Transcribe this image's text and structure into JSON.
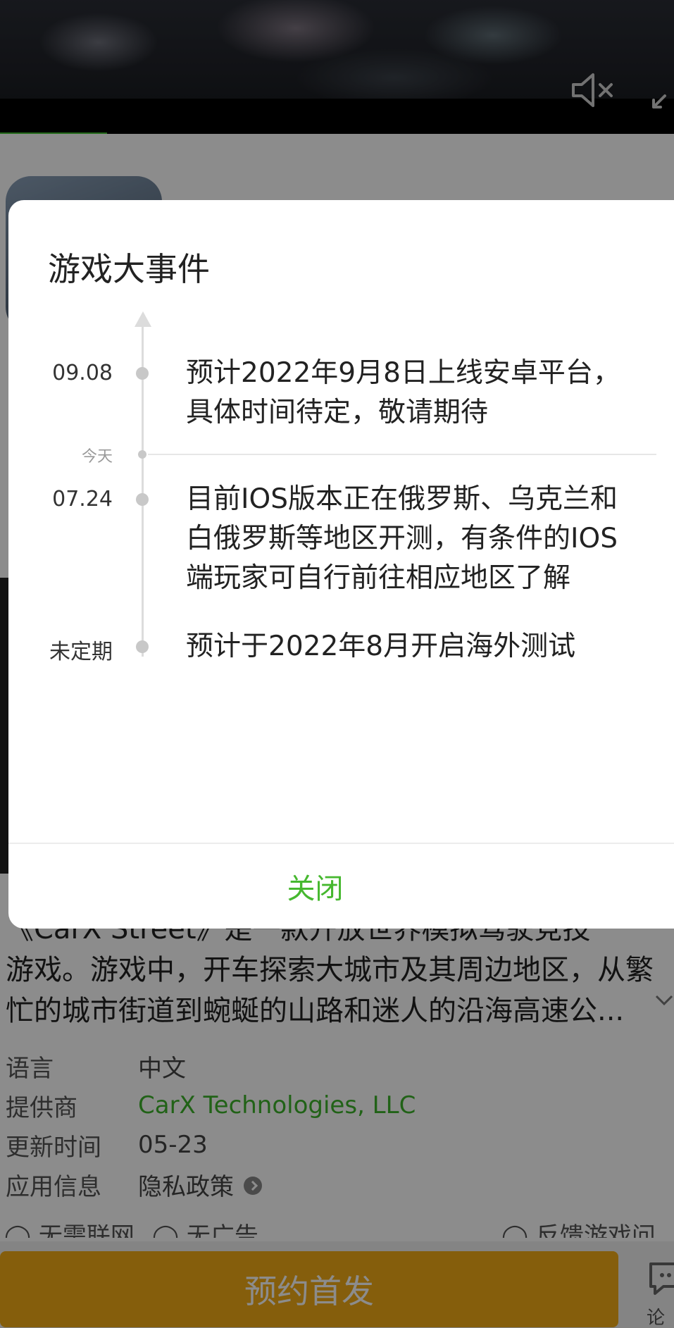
{
  "colors": {
    "accent_green": "#46b82f",
    "reserve_orange": "#f3ab16",
    "overlay": "rgba(0,0,0,0.45)"
  },
  "video": {
    "icons": [
      "mute-icon",
      "fullscreen-icon"
    ]
  },
  "description": {
    "lines": [
      "《CarX Street》是一款开放世界模拟驾驶竞技",
      "游戏。游戏中，开车探索大城市及其周边地区，从繁",
      "忙的城市街道到蜿蜒的山路和迷人的沿海高速公..."
    ]
  },
  "info": [
    {
      "key": "语言",
      "value": "中文"
    },
    {
      "key": "提供商",
      "value": "CarX Technologies, LLC"
    },
    {
      "key": "更新时间",
      "value": "05-23"
    },
    {
      "key": "应用信息",
      "value": "隐私政策"
    }
  ],
  "badges": [
    "◯ 无需联网",
    "◯ 无广告",
    "◯ 反馈游戏问题"
  ],
  "bottom": {
    "reserve_label": "预约首发",
    "forum_label": "论坛"
  },
  "modal": {
    "title": "游戏大事件",
    "today_label": "今天",
    "events": [
      {
        "date": "09.08",
        "lines": [
          "预计2022年9月8日上线安卓平台，",
          "具体时间待定，敬请期待"
        ]
      },
      {
        "date": "07.24",
        "lines": [
          "目前IOS版本正在俄罗斯、乌克兰和",
          "白俄罗斯等地区开测，有条件的IOS",
          "端玩家可自行前往相应地区了解"
        ]
      },
      {
        "date": "未定期",
        "lines": [
          "预计于2022年8月开启海外测试"
        ]
      }
    ],
    "close_label": "关闭"
  }
}
